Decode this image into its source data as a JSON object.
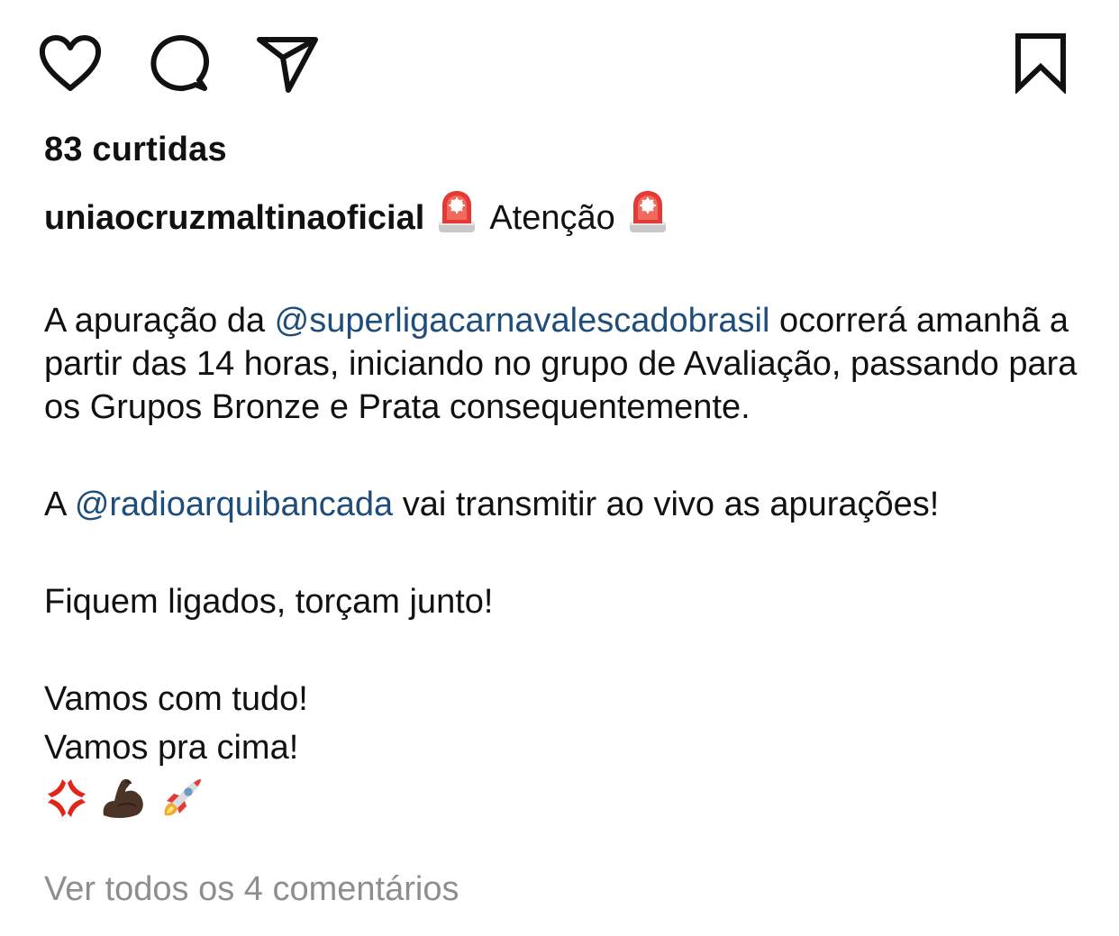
{
  "actions": {
    "like_icon": "heart-icon",
    "comment_icon": "speech-bubble-icon",
    "share_icon": "paper-plane-icon",
    "save_icon": "bookmark-icon"
  },
  "likes": {
    "text": "83 curtidas"
  },
  "caption": {
    "username": "uniaocruzmaltinaoficial",
    "headline": "Atenção",
    "headline_emoji": "police-light-emoji",
    "p1_before": "A apuração da ",
    "p1_mention": "@superligacarnavalescadobrasil",
    "p1_after": " ocorrerá amanhã a partir das 14 horas, iniciando no grupo de Avaliação, passando para os Grupos Bronze e Prata consequentemente.",
    "p2_before": "A ",
    "p2_mention": "@radioarquibancada",
    "p2_after": " vai transmitir ao vivo as apurações!",
    "p3": "Fiquem ligados, torçam junto!",
    "p4_line1": "Vamos com tudo!",
    "p4_line2": "Vamos pra cima!",
    "emojis": [
      "anger-symbol-emoji",
      "flexed-biceps-emoji",
      "rocket-emoji"
    ]
  },
  "comments": {
    "view_all": "Ver todos os 4 comentários"
  },
  "colors": {
    "text": "#111111",
    "mention": "#1f4d7a",
    "muted": "#8e8e8e"
  }
}
